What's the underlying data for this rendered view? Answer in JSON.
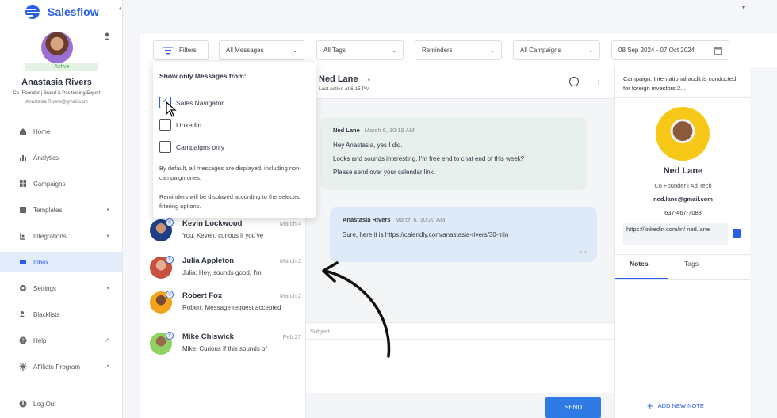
{
  "app": {
    "name": "Salesflow"
  },
  "profile": {
    "status": "Active",
    "name": "Anastasia Rivers",
    "title": "Co- Founder | Brand & Positioning Expert",
    "email": "Anastasia Rivers@gmail.com"
  },
  "nav": {
    "items": [
      {
        "label": "Home",
        "icon": "home-icon"
      },
      {
        "label": "Analytics",
        "icon": "analytics-icon"
      },
      {
        "label": "Campaigns",
        "icon": "campaigns-icon"
      },
      {
        "label": "Templates",
        "icon": "templates-icon",
        "trail": "▾"
      },
      {
        "label": "Integrations",
        "icon": "integrations-icon",
        "trail": "▾"
      },
      {
        "label": "Inbox",
        "icon": "inbox-icon",
        "active": true
      },
      {
        "label": "Settings",
        "icon": "gear-icon",
        "trail": "▾"
      },
      {
        "label": "Blacklists",
        "icon": "blacklists-icon"
      },
      {
        "label": "Help",
        "icon": "help-icon",
        "trail": "↗"
      },
      {
        "label": "Affiliate Program",
        "icon": "affiliate-icon",
        "trail": "↗"
      }
    ],
    "logout": "Log Out"
  },
  "filters": {
    "filters_label": "Filters",
    "messages": "All Messages",
    "tags": "All Tags",
    "reminders": "Reminders",
    "campaigns": "All Campaigns",
    "date_range": "08 Sep 2024 - 07 Oct 2024"
  },
  "dropdown": {
    "title": "Show only Messages from:",
    "options": [
      "Sales Navigator",
      "LinkedIn",
      "Campaigns only"
    ],
    "note1": "By default, all messages are displayed, including non-campaign ones.",
    "note2": "Reminders will be displayed according to the selected filtering options."
  },
  "conversations": [
    {
      "name": "Kevin Lockwood",
      "date": "March 4",
      "preview": "You: Keven, curious if you've"
    },
    {
      "name": "Julia Appleton",
      "date": "March 2",
      "preview": "Julia: Hey, sounds good, I'm"
    },
    {
      "name": "Robert Fox",
      "date": "March 2",
      "preview": "Robert: Message request accepted"
    },
    {
      "name": "Mike Chiswick",
      "date": "Feb 27",
      "preview": "Mike: Curious if this sounds of"
    }
  ],
  "chat": {
    "contact": "Ned Lane",
    "last_active": "Last active at 6:15 PM",
    "incoming": {
      "sender": "Ned Lane",
      "time": "March 6, 10:19 AM",
      "lines": [
        "Hey Anastasia, yes I did.",
        "Looks and sounds interesting,  I'm free end to chat end of this week?",
        "Please send over your calendar link."
      ]
    },
    "outgoing": {
      "sender": "Anastasia Rivers",
      "time": "March 6, 10:20 AM",
      "text": "Sure, here it is https://calendly.com/anastasia-rivers/30-min"
    },
    "subject_placeholder": "Subject",
    "send": "SEND"
  },
  "contact": {
    "campaign": "Campaign: International audit is conducted for foreign investors 2...",
    "name": "Ned Lane",
    "title": "Co Founder | Ad Tech",
    "email": "ned.lane@gmail.com",
    "phone": "637-467-7088",
    "linkedin": "https://linkedin.com/in/ ned.lane",
    "tabs": [
      "Notes",
      "Tags"
    ],
    "add_note": "ADD NEW NOTE"
  },
  "colors": {
    "accent": "#2a5ee8",
    "send": "#2e7be6",
    "active_green": "#45a84a"
  }
}
